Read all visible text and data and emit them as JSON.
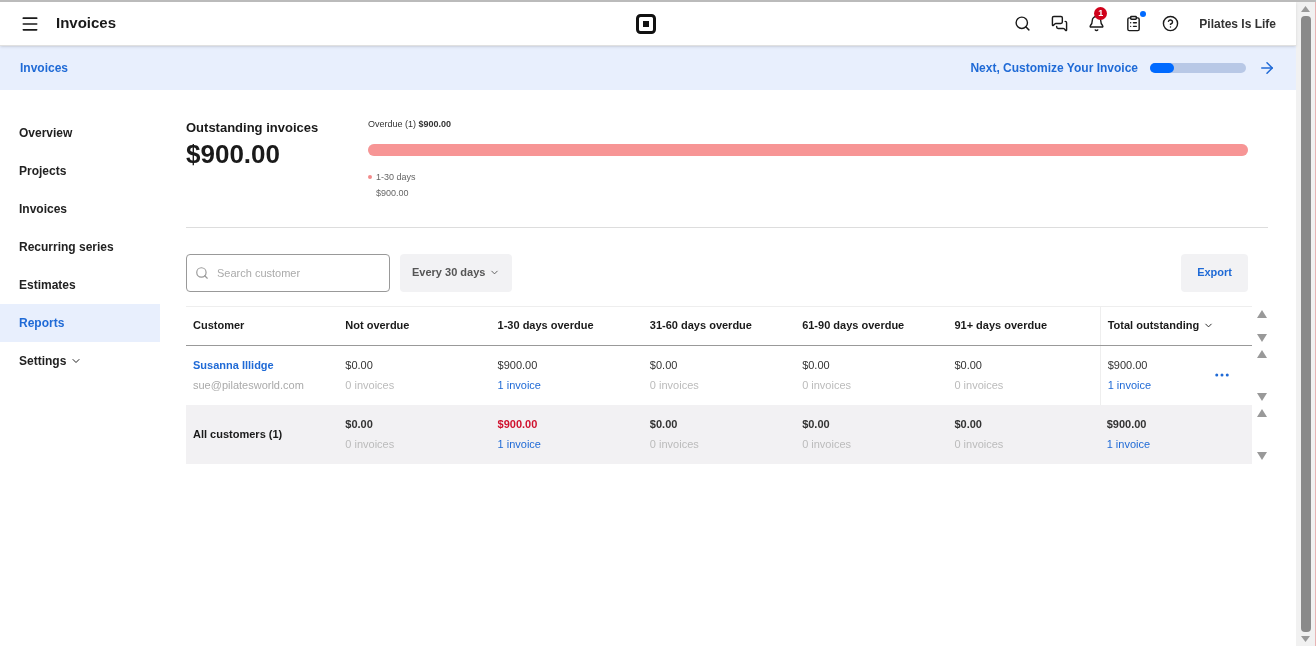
{
  "header": {
    "title": "Invoices",
    "notification_count": "1",
    "clipboard_dot": true,
    "account": "Pilates Is Life"
  },
  "banner": {
    "title": "Invoices",
    "next_step": "Next, Customize Your Invoice",
    "level": 0.25
  },
  "sidebar": {
    "items": [
      {
        "label": "Overview",
        "selected": false
      },
      {
        "label": "Projects",
        "selected": false
      },
      {
        "label": "Invoices",
        "selected": false
      },
      {
        "label": "Recurring series",
        "selected": false
      },
      {
        "label": "Estimates",
        "selected": false
      },
      {
        "label": "Reports",
        "selected": true
      },
      {
        "label": "Settings",
        "selected": false,
        "dropdown": true
      }
    ]
  },
  "summary": {
    "title": "Outstanding invoices",
    "amount": "$900.00",
    "overdue_label": "Overdue (1)",
    "overdue_amount": "$900.00",
    "level": 1,
    "legend": [
      {
        "label": "1-30 days",
        "amount": "$900.00",
        "color": "#f28b8b"
      }
    ]
  },
  "filters": {
    "search_placeholder": "Search customer",
    "period": "Every 30 days",
    "export": "Export"
  },
  "table": {
    "customer_column": "Customer",
    "columns": [
      "Not overdue",
      "1-30 days overdue",
      "31-60 days overdue",
      "61-90 days overdue",
      "91+ days overdue",
      "Total outstanding"
    ],
    "rows": [
      {
        "kind": "customer",
        "name": "Susanna Illidge",
        "email": "sue@pilatesworld.com",
        "cells": [
          {
            "amount": "$0.00",
            "count": "0 invoices",
            "linked": false,
            "alert": false
          },
          {
            "amount": "$900.00",
            "count": "1 invoice",
            "linked": true,
            "alert": false
          },
          {
            "amount": "$0.00",
            "count": "0 invoices",
            "linked": false,
            "alert": false
          },
          {
            "amount": "$0.00",
            "count": "0 invoices",
            "linked": false,
            "alert": false
          },
          {
            "amount": "$0.00",
            "count": "0 invoices",
            "linked": false,
            "alert": false
          },
          {
            "amount": "$900.00",
            "count": "1 invoice",
            "linked": true,
            "alert": false
          }
        ]
      },
      {
        "kind": "total",
        "name": "All customers (1)",
        "cells": [
          {
            "amount": "$0.00",
            "count": "0 invoices",
            "linked": false,
            "alert": false
          },
          {
            "amount": "$900.00",
            "count": "1 invoice",
            "linked": true,
            "alert": true
          },
          {
            "amount": "$0.00",
            "count": "0 invoices",
            "linked": false,
            "alert": false
          },
          {
            "amount": "$0.00",
            "count": "0 invoices",
            "linked": false,
            "alert": false
          },
          {
            "amount": "$0.00",
            "count": "0 invoices",
            "linked": false,
            "alert": false
          },
          {
            "amount": "$900.00",
            "count": "1 invoice",
            "linked": true,
            "alert": false
          }
        ]
      }
    ]
  }
}
